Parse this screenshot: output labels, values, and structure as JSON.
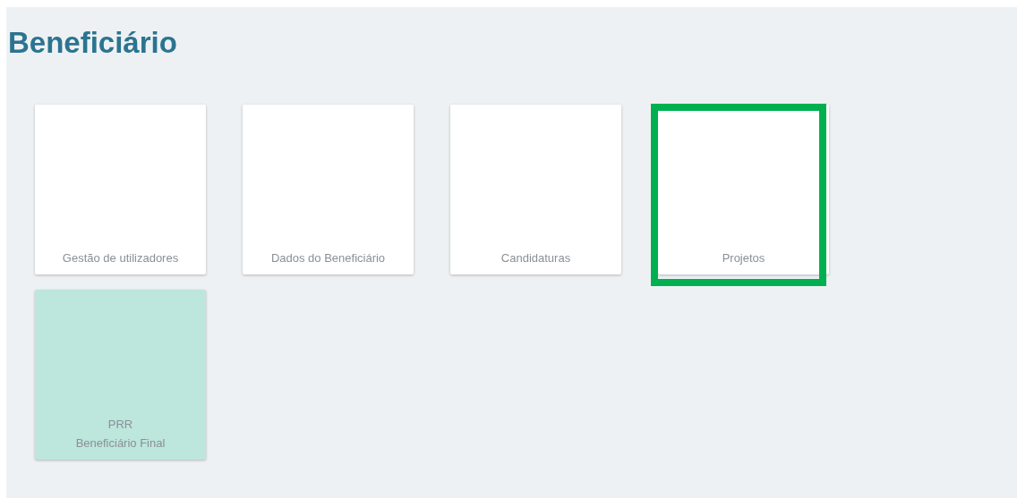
{
  "title": "Beneficiário",
  "tiles": [
    {
      "lines": [
        "Gestão de utilizadores"
      ],
      "kind": "plain",
      "highlighted": false
    },
    {
      "lines": [
        "Dados do Beneficiário"
      ],
      "kind": "plain",
      "highlighted": false
    },
    {
      "lines": [
        "Candidaturas"
      ],
      "kind": "plain",
      "highlighted": false
    },
    {
      "lines": [
        "Projetos"
      ],
      "kind": "plain",
      "highlighted": true
    },
    {
      "lines": [
        "PRR",
        "Beneficiário Final"
      ],
      "kind": "accent",
      "highlighted": false
    }
  ]
}
